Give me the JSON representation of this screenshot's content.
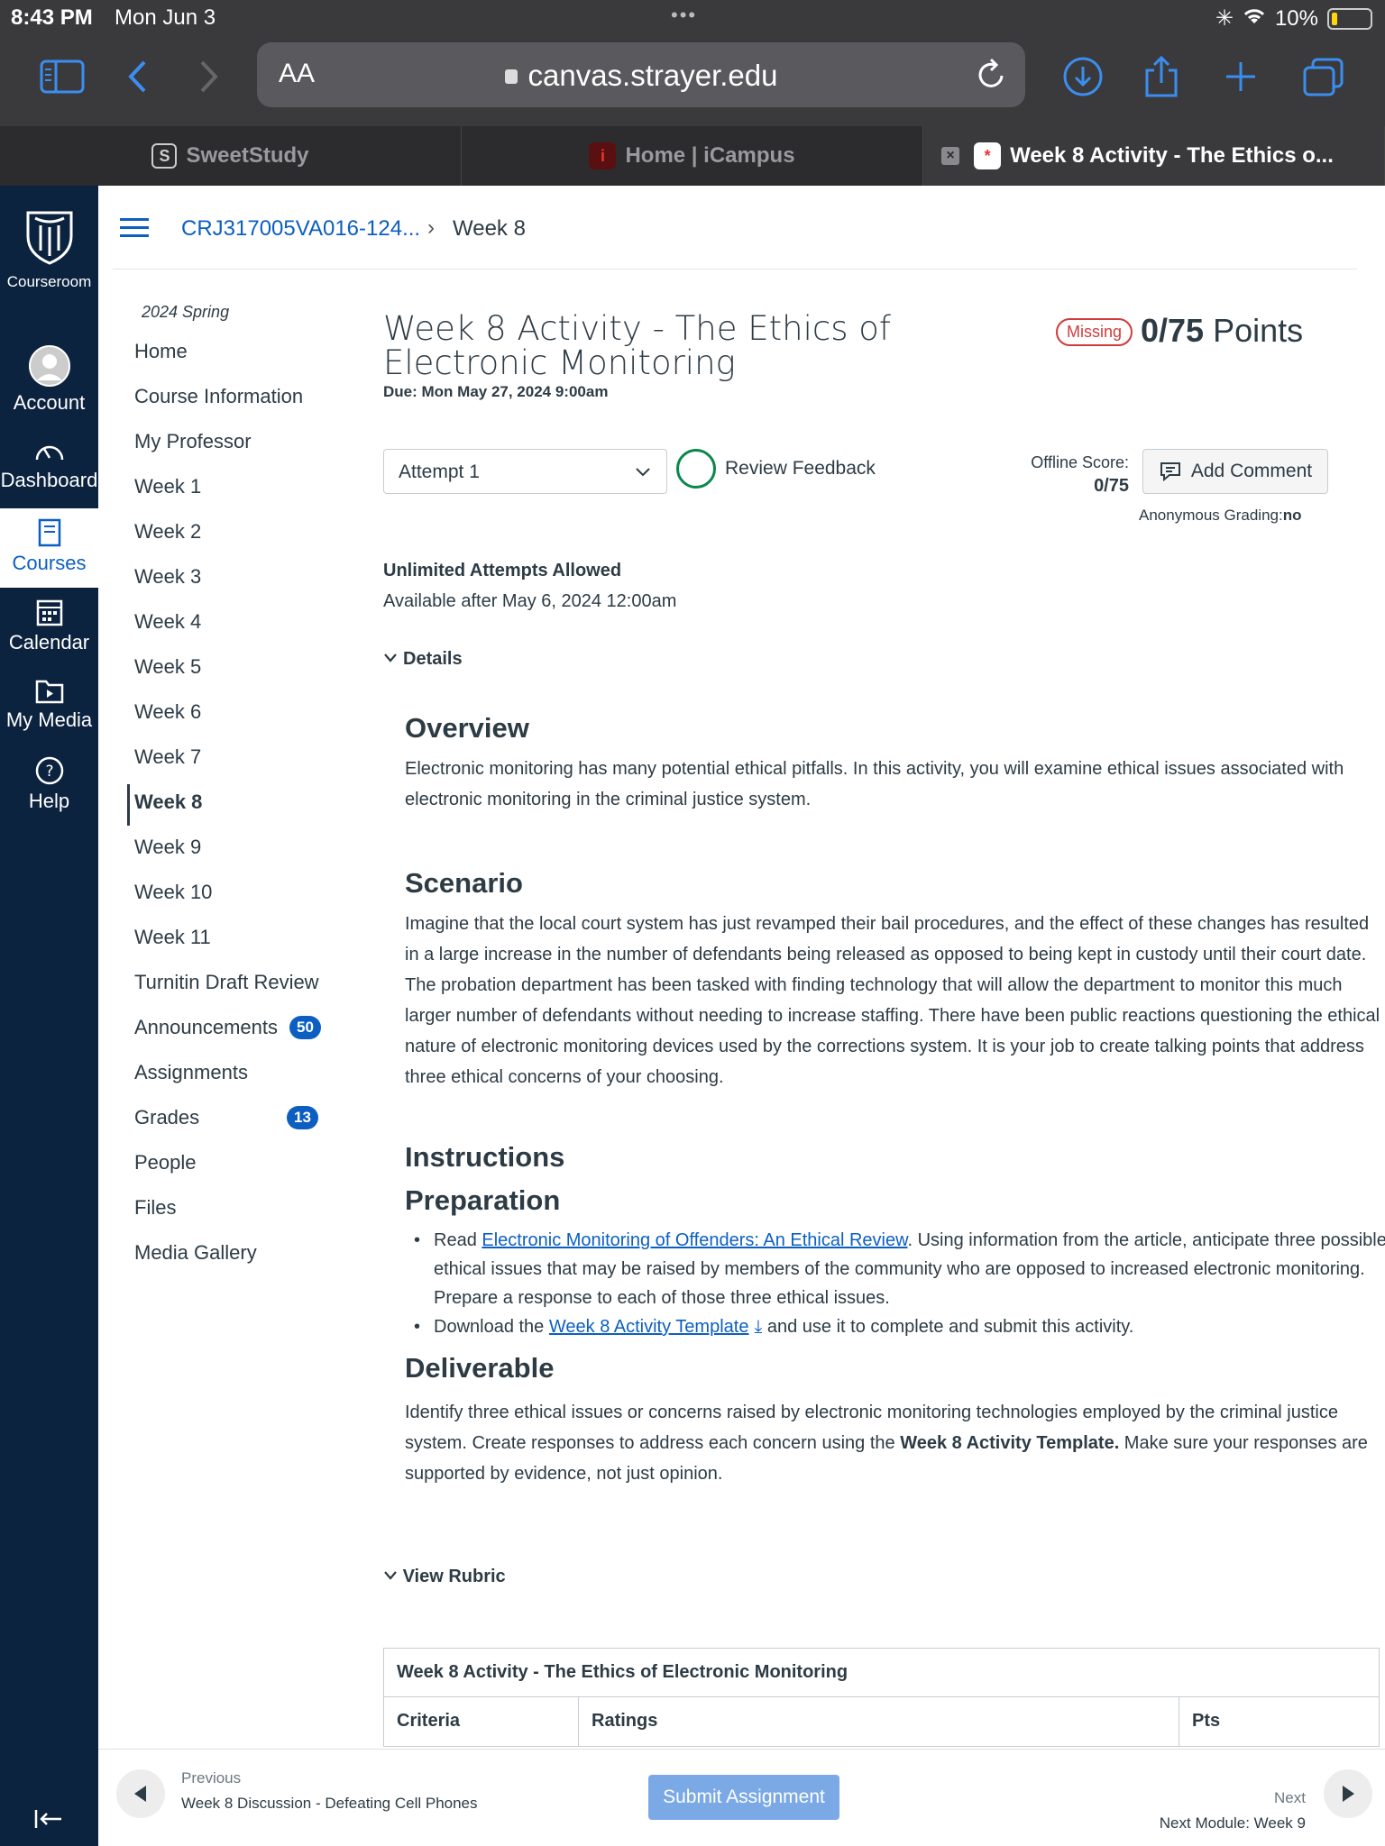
{
  "status": {
    "time": "8:43 PM",
    "date": "Mon Jun 3",
    "battery": "10%"
  },
  "browser": {
    "aa_label": "AA",
    "host": "canvas.strayer.edu"
  },
  "tabs": [
    {
      "favicon": "S",
      "label": "SweetStudy"
    },
    {
      "favicon": "i",
      "label": "Home | iCampus"
    },
    {
      "favicon": "*",
      "label": "Week 8 Activity - The Ethics o..."
    }
  ],
  "global_nav": {
    "logo_label": "Courseroom",
    "items": [
      {
        "label": "Account",
        "icon": "account-icon"
      },
      {
        "label": "Dashboard",
        "icon": "dashboard-icon"
      },
      {
        "label": "Courses",
        "icon": "courses-icon"
      },
      {
        "label": "Calendar",
        "icon": "calendar-icon"
      },
      {
        "label": "My Media",
        "icon": "media-icon"
      },
      {
        "label": "Help",
        "icon": "help-icon"
      }
    ]
  },
  "breadcrumb": {
    "course": "CRJ317005VA016-124...",
    "current": "Week 8"
  },
  "course_nav": {
    "term": "2024 Spring",
    "items": [
      {
        "label": "Home"
      },
      {
        "label": "Course Information"
      },
      {
        "label": "My Professor"
      },
      {
        "label": "Week 1"
      },
      {
        "label": "Week 2"
      },
      {
        "label": "Week 3"
      },
      {
        "label": "Week 4"
      },
      {
        "label": "Week 5"
      },
      {
        "label": "Week 6"
      },
      {
        "label": "Week 7"
      },
      {
        "label": "Week 8"
      },
      {
        "label": "Week 9"
      },
      {
        "label": "Week 10"
      },
      {
        "label": "Week 11"
      },
      {
        "label": "Turnitin Draft Review"
      },
      {
        "label": "Announcements",
        "badge": "50"
      },
      {
        "label": "Assignments"
      },
      {
        "label": "Grades",
        "badge": "13"
      },
      {
        "label": "People"
      },
      {
        "label": "Files"
      },
      {
        "label": "Media Gallery"
      }
    ]
  },
  "assignment": {
    "title": "Week 8 Activity - The Ethics of Electronic Monitoring",
    "due": "Due: Mon May 27, 2024 9:00am",
    "missing": "Missing",
    "points_value": "0/75",
    "points_label": "Points",
    "attempt": "Attempt 1",
    "review_feedback": "Review Feedback",
    "offline_label": "Offline Score:",
    "offline_value": "0/75",
    "add_comment": "Add Comment",
    "anon_label": "Anonymous Grading:",
    "anon_value": "no",
    "unlimited": "Unlimited Attempts Allowed",
    "available": "Available after May 6, 2024 12:00am",
    "details": "Details"
  },
  "content": {
    "overview_h": "Overview",
    "overview_p": "Electronic monitoring has many potential ethical pitfalls. In this activity, you will examine ethical issues associated with electronic monitoring in the criminal justice system.",
    "scenario_h": "Scenario",
    "scenario_p": "Imagine that the local court system has just revamped their bail procedures, and the effect of these changes has resulted in a large increase in the number of defendants being released as opposed to being kept in custody until their court date. The probation department has been tasked with finding technology that will allow the department to monitor this much larger number of defendants without needing to increase staffing. There have been public reactions questioning the ethical nature of electronic monitoring devices used by the corrections system. It is your job to create talking points that address three ethical concerns of your choosing.",
    "instructions_h": "Instructions",
    "preparation_h": "Preparation",
    "bullet1_pre": "Read ",
    "bullet1_link": "Electronic Monitoring of Offenders: An Ethical Review",
    "bullet1_post": ". Using information from the article, anticipate three possible ethical issues that may be raised by members of the community who are opposed to increased electronic monitoring. Prepare a response to each of those three ethical issues.",
    "bullet2_pre": "Download the ",
    "bullet2_link": "Week 8 Activity Template",
    "bullet2_post": " and use it to complete and submit this activity.",
    "deliverable_h": "Deliverable",
    "deliverable_pre": "Identify three ethical issues or concerns raised by electronic monitoring technologies employed by the criminal justice system. Create responses to address each concern using the ",
    "deliverable_bold": "Week 8 Activity Template.",
    "deliverable_post": " Make sure your responses are supported by evidence, not just opinion."
  },
  "rubric": {
    "toggle": "View Rubric",
    "title": "Week 8 Activity - The Ethics of Electronic Monitoring",
    "col_criteria": "Criteria",
    "col_ratings": "Ratings",
    "col_pts": "Pts"
  },
  "footer": {
    "prev_label": "Previous",
    "prev_name": "Week 8 Discussion - Defeating Cell Phones",
    "submit": "Submit Assignment",
    "next_label": "Next",
    "next_name": "Next Module: Week 9"
  },
  "colors": {
    "nav_bg": "#0c2340",
    "link": "#0c5fc1",
    "missing": "#d13b3b",
    "review_ring": "#0b874b"
  }
}
